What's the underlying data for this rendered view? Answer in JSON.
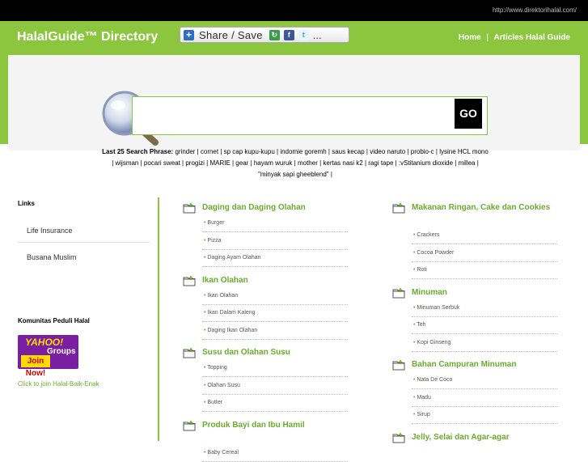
{
  "topbar": {
    "url": "http://www.direktorihalal.com/"
  },
  "header": {
    "brand": "HalalGuide™ Directory",
    "share_label": "Share / Save",
    "more": "...",
    "nav": [
      "Home",
      "Articles Halal Guide"
    ],
    "nav_separator": "|"
  },
  "search": {
    "placeholder": "",
    "button": "GO",
    "phrases_label": "Last 25 Search Phrase:",
    "phrases": [
      "grinder",
      "cornet",
      "sp cap kupu-kupu",
      "indomie goremh",
      "saus kecap",
      "video naruto",
      "probio-c",
      "lysine HCL mono",
      "wijsman",
      "pocari sweat",
      "progizi",
      "MARIE",
      "gear",
      "hayam wuruk",
      "mother",
      "kertas nasi k2",
      "ragi tape",
      ":vStitanium dioxide",
      "millea",
      "\"minyak sapi gheeblend\""
    ]
  },
  "sidebar": {
    "links_title": "Links",
    "links": [
      "Life Insurance",
      "Busana Muslim"
    ],
    "community_title": "Komunitas Peduli Halal",
    "yahoo": {
      "brand": "YAHOO!",
      "groups": "Groups",
      "join": "Join Now!"
    },
    "join_link": "Click to join Halal-Baik-Enak"
  },
  "categories_left": [
    {
      "title": "Daging dan Daging Olahan",
      "items": [
        "Burger",
        "Pizza",
        "Daging Ayam Olahan"
      ]
    },
    {
      "title": "Ikan Olahan",
      "items": [
        "Ikan Olahan",
        "Ikan Dalam Kaleng",
        "Daging Ikan Olahan"
      ]
    },
    {
      "title": "Susu dan Olahan Susu",
      "items": [
        "Topping",
        "Olahan Susu",
        "Butter"
      ]
    },
    {
      "title": "Produk Bayi dan Ibu Hamil",
      "items": [
        "Baby Cereal"
      ]
    }
  ],
  "categories_right": [
    {
      "title": "Makanan Ringan, Cake dan Cookies",
      "items": [
        "Crackers",
        "Cocoa Powder",
        "Roti"
      ]
    },
    {
      "title": "Minuman",
      "items": [
        "Minuman Serbuk",
        "Teh",
        "Kopi Ginseng"
      ]
    },
    {
      "title": "Bahan Campuran Minuman",
      "items": [
        "Nata De Coco",
        "Madu",
        "Sirup"
      ]
    },
    {
      "title": "Jelly, Selai dan Agar-agar",
      "items": []
    }
  ],
  "colors": {
    "accent": "#8cc63f",
    "link": "#6aad2d",
    "topbar": "#000000"
  }
}
